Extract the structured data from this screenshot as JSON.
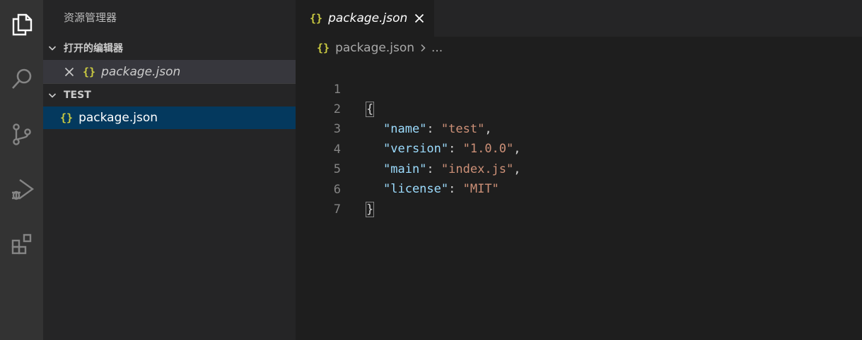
{
  "activity_bar": {
    "items": [
      {
        "icon": "explorer-icon"
      },
      {
        "icon": "search-icon"
      },
      {
        "icon": "source-control-icon"
      },
      {
        "icon": "run-debug-icon"
      },
      {
        "icon": "extensions-icon"
      }
    ]
  },
  "sidebar": {
    "title": "资源管理器",
    "open_editors": {
      "label": "打开的编辑器",
      "items": [
        {
          "brace": "{}",
          "name": "package.json"
        }
      ]
    },
    "folder": {
      "label": "TEST",
      "items": [
        {
          "brace": "{}",
          "name": "package.json"
        }
      ]
    }
  },
  "tabs": [
    {
      "brace": "{}",
      "label": "package.json"
    }
  ],
  "breadcrumb": {
    "brace": "{}",
    "file": "package.json",
    "ellipsis": "..."
  },
  "editor": {
    "line_numbers": [
      "1",
      "2",
      "3",
      "4",
      "5",
      "6",
      "7"
    ],
    "lines": {
      "l1": "{",
      "l2_key": "\"name\"",
      "l2_colon": ": ",
      "l2_val": "\"test\"",
      "l2_comma": ",",
      "l3_key": "\"version\"",
      "l3_colon": ": ",
      "l3_val": "\"1.0.0\"",
      "l3_comma": ",",
      "l4_key": "\"main\"",
      "l4_colon": ": ",
      "l4_val": "\"index.js\"",
      "l4_comma": ",",
      "l5_key": "\"license\"",
      "l5_colon": ": ",
      "l5_val": "\"MIT\"",
      "l6": "}"
    }
  },
  "colors": {
    "activity_bar": "#333333",
    "sidebar": "#252526",
    "editor": "#1e1e1e",
    "selection": "#04395e",
    "json_key": "#9cdcfe",
    "json_string": "#ce9178",
    "json_icon": "#cbcb41"
  }
}
